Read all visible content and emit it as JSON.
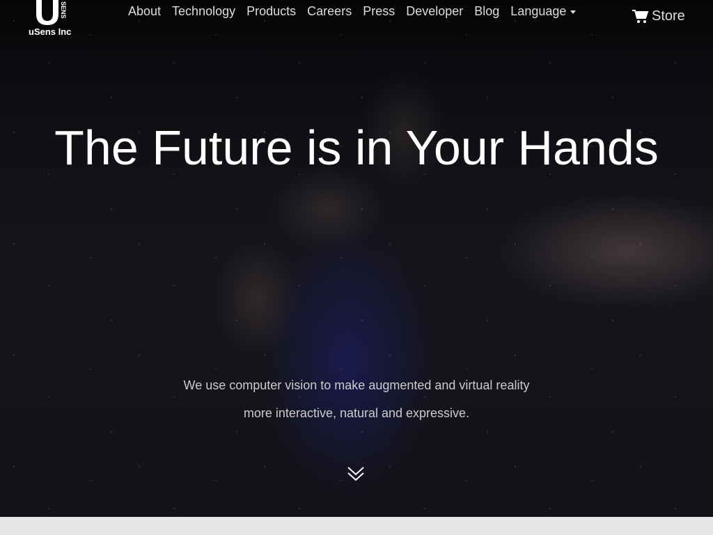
{
  "brand": {
    "name": "uSens Inc",
    "mark": "SENS"
  },
  "nav": {
    "items": [
      {
        "label": "About"
      },
      {
        "label": "Technology"
      },
      {
        "label": "Products"
      },
      {
        "label": "Careers"
      },
      {
        "label": "Press"
      },
      {
        "label": "Developer"
      },
      {
        "label": "Blog"
      }
    ],
    "language": "Language"
  },
  "store": {
    "label": "Store"
  },
  "hero": {
    "title": "The Future is in Your Hands",
    "line1": "We use computer vision to make augmented and virtual reality",
    "line2": "more interactive, natural and expressive."
  }
}
